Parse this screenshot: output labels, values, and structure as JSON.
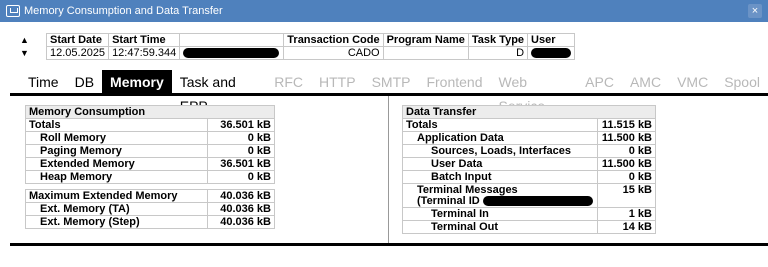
{
  "window": {
    "title": "Memory Consumption and Data Transfer",
    "close_glyph": "×"
  },
  "header": {
    "columns": [
      "Start Date",
      "Start Time",
      "",
      "Transaction Code",
      "Program Name",
      "Task Type",
      "User"
    ],
    "values": {
      "start_date": "12.05.2025",
      "start_time": "12:47:59.344",
      "transaction_code": "CADO",
      "program_name": "",
      "task_type": "D"
    },
    "nav_up": "▲",
    "nav_down": "▼"
  },
  "tabs": [
    {
      "label": "Time",
      "state": "normal"
    },
    {
      "label": "DB",
      "state": "normal"
    },
    {
      "label": "Memory",
      "state": "active"
    },
    {
      "label": "Task and EPP",
      "state": "normal"
    },
    {
      "label": "RFC",
      "state": "disabled"
    },
    {
      "label": "HTTP",
      "state": "disabled"
    },
    {
      "label": "SMTP",
      "state": "disabled"
    },
    {
      "label": "Frontend",
      "state": "disabled"
    },
    {
      "label": "Web Service",
      "state": "disabled"
    },
    {
      "label": "APC",
      "state": "disabled"
    },
    {
      "label": "AMC",
      "state": "disabled"
    },
    {
      "label": "VMC",
      "state": "disabled"
    },
    {
      "label": "Spool",
      "state": "disabled"
    }
  ],
  "memory": {
    "heading": "Memory Consumption",
    "rows": [
      {
        "label": "Totals",
        "value": "36.501 kB"
      },
      {
        "label": "Roll Memory",
        "value": "0 kB"
      },
      {
        "label": "Paging Memory",
        "value": "0 kB"
      },
      {
        "label": "Extended Memory",
        "value": "36.501 kB"
      },
      {
        "label": "Heap Memory",
        "value": "0 kB"
      }
    ],
    "rows2": [
      {
        "label": "Maximum Extended Memory",
        "value": "40.036 kB"
      },
      {
        "label": "Ext. Memory (TA)",
        "value": "40.036 kB"
      },
      {
        "label": "Ext. Memory (Step)",
        "value": "40.036 kB"
      }
    ]
  },
  "transfer": {
    "heading": "Data Transfer",
    "rows": [
      {
        "label": "Totals",
        "value": "11.515 kB"
      },
      {
        "label": "Application Data",
        "value": "11.500 kB"
      },
      {
        "label": "Sources, Loads, Interfaces",
        "value": "0 kB"
      },
      {
        "label": "User Data",
        "value": "11.500 kB"
      },
      {
        "label": "Batch Input",
        "value": "0 kB"
      },
      {
        "label": "Terminal Messages",
        "label2": "(Terminal ID",
        "value": "15 kB"
      },
      {
        "label": "Terminal In",
        "value": "1 kB"
      },
      {
        "label": "Terminal Out",
        "value": "14 kB"
      }
    ]
  }
}
